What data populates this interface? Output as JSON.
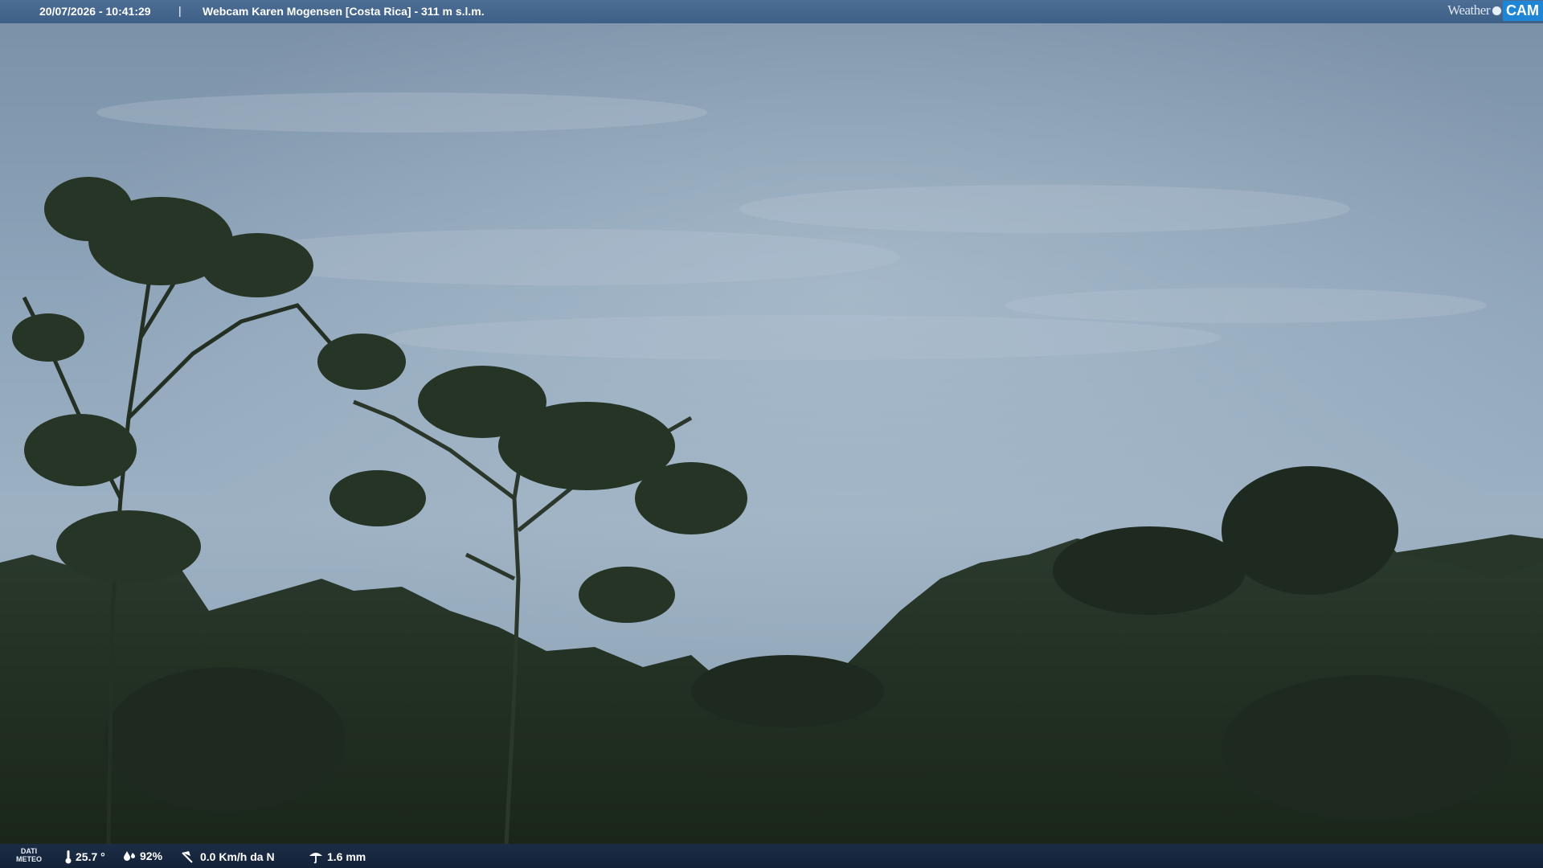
{
  "header": {
    "timestamp": "20/07/2026 - 10:41:29",
    "separator": "|",
    "camera_title": "Webcam Karen Mogensen [Costa Rica]  - 311 m s.l.m.",
    "logo_left": "Weather",
    "logo_right": "CAM"
  },
  "footer": {
    "dati_line1": "DATI",
    "dati_line2": "METEO",
    "temperature": "25.7 °",
    "humidity": "92%",
    "wind": "0.0 Km/h da N",
    "rain": "1.6 mm"
  },
  "icons": {
    "temperature": "thermometer-icon",
    "humidity": "humidity-drop-icon",
    "wind": "wind-icon",
    "rain": "rain-gauge-icon"
  },
  "colors": {
    "sky_top": "#7d93a8",
    "sky_bottom": "#a3b6c7",
    "forest": "#1f2d20",
    "header_bar": "#45668d",
    "footer_bar": "#17263c",
    "logo_accent": "#1f86d6"
  }
}
